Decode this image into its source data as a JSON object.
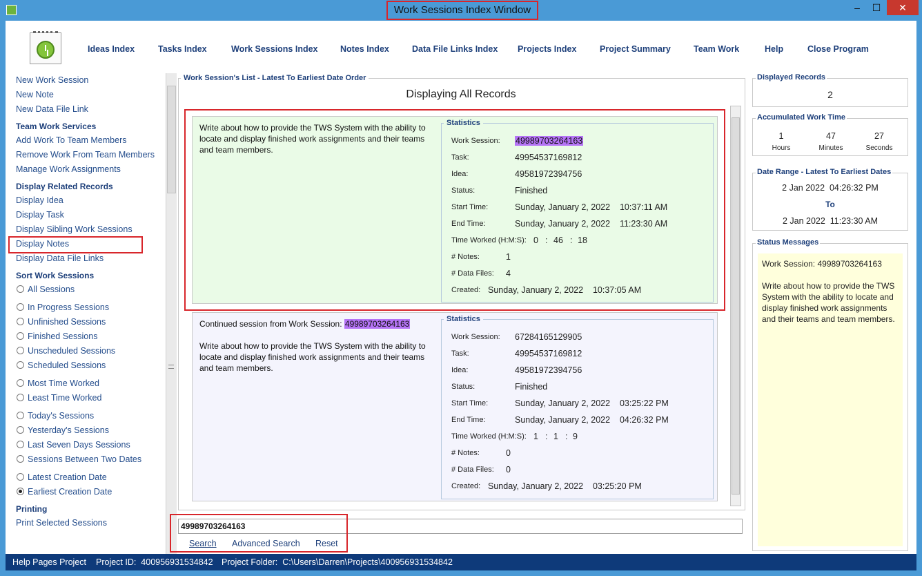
{
  "window": {
    "title": "Work Sessions Index Window",
    "minimize": "–",
    "maximize": "☐",
    "close": "✕"
  },
  "menu": [
    "Ideas Index",
    "Tasks Index",
    "Work Sessions Index",
    "Notes Index",
    "Data File Links Index",
    "Projects Index",
    "Project Summary",
    "Team Work",
    "Help",
    "Close Program"
  ],
  "sidebar": {
    "new_work_session": "New Work Session",
    "new_note": "New Note",
    "new_data_file_link": "New Data File Link",
    "team_work_services": "Team Work Services",
    "add_work": "Add Work To Team Members",
    "remove_work": "Remove Work From Team Members",
    "manage_assignments": "Manage Work Assignments",
    "display_related": "Display Related Records",
    "display_idea": "Display Idea",
    "display_task": "Display Task",
    "display_sibling": "Display Sibling Work Sessions",
    "display_notes": "Display Notes",
    "display_data_links": "Display Data File Links",
    "sort_heading": "Sort Work Sessions",
    "sort_options": [
      "All Sessions",
      "In Progress Sessions",
      "Unfinished Sessions",
      "Finished Sessions",
      "Unscheduled Sessions",
      "Scheduled Sessions",
      "Most Time Worked",
      "Least Time Worked",
      "Today's Sessions",
      "Yesterday's Sessions",
      "Last Seven Days Sessions",
      "Sessions Between Two Dates",
      "Latest Creation Date",
      "Earliest Creation Date"
    ],
    "selected_sort": "Earliest Creation Date",
    "printing": "Printing",
    "print_selected": "Print Selected Sessions"
  },
  "list": {
    "legend": "Work Session's List - Latest To Earliest Date Order",
    "display_all": "Displaying All Records",
    "stats_legend": "Statistics",
    "labels": {
      "work_session": "Work Session:",
      "task": "Task:",
      "idea": "Idea:",
      "status": "Status:",
      "start": "Start Time:",
      "end": "End Time:",
      "time_worked": "Time Worked (H:M:S):",
      "notes": "# Notes:",
      "data_files": "# Data Files:",
      "created": "Created:"
    },
    "sessions": [
      {
        "prefix": "",
        "prefix_id": "",
        "description": "Write about how to provide the TWS System with the ability to locate and display finished work assignments and their teams and team members.",
        "work_session": "49989703264163",
        "task": "49954537169812",
        "idea": "49581972394756",
        "status": "Finished",
        "start_time": "Sunday, January 2, 2022    10:37:11 AM",
        "end_time": "Sunday, January 2, 2022    11:23:30 AM",
        "hours": "0",
        "minutes": "46",
        "seconds": "18",
        "notes": "1",
        "data_files": "4",
        "created": "Sunday, January 2, 2022    10:37:05 AM",
        "bg": "#eafbe7"
      },
      {
        "prefix": "Continued session from Work Session:",
        "prefix_id": "49989703264163",
        "description": "Write about how to provide the TWS System with the ability to locate and display finished work assignments and their teams and team members.",
        "work_session": "67284165129905",
        "task": "49954537169812",
        "idea": "49581972394756",
        "status": "Finished",
        "start_time": "Sunday, January 2, 2022    03:25:22 PM",
        "end_time": "Sunday, January 2, 2022    04:26:32 PM",
        "hours": "1",
        "minutes": "1",
        "seconds": "9",
        "notes": "0",
        "data_files": "0",
        "created": "Sunday, January 2, 2022    03:25:20 PM",
        "bg": "#f4f4fd"
      }
    ]
  },
  "search": {
    "value": "49989703264163",
    "search": "Search",
    "advanced": "Advanced Search",
    "reset": "Reset"
  },
  "right": {
    "displayed_label": "Displayed Records",
    "displayed_count": "2",
    "accum_label": "Accumulated Work Time",
    "hours": "1",
    "hours_unit": "Hours",
    "minutes": "47",
    "minutes_unit": "Minutes",
    "seconds": "27",
    "seconds_unit": "Seconds",
    "range_label": "Date Range - Latest To Earliest Dates",
    "range_from": "2 Jan 2022  04:26:32 PM",
    "range_to_label": "To",
    "range_to": "2 Jan 2022  11:23:30 AM",
    "status_label": "Status Messages",
    "status_line1": "Work Session: 49989703264163",
    "status_line2": "Write about how to provide the TWS System with the ability to locate and display finished work assignments and their teams and team members."
  },
  "statusbar": {
    "project": "Help Pages Project",
    "project_id": "Project ID:  400956931534842",
    "folder": "Project Folder:  C:\\Users\\Darren\\Projects\\400956931534842"
  },
  "colors": {
    "accent": "#4a9ad6",
    "highlight": "#b574f6",
    "callout": "#d8262b",
    "statusbar": "#0e3a7a"
  }
}
